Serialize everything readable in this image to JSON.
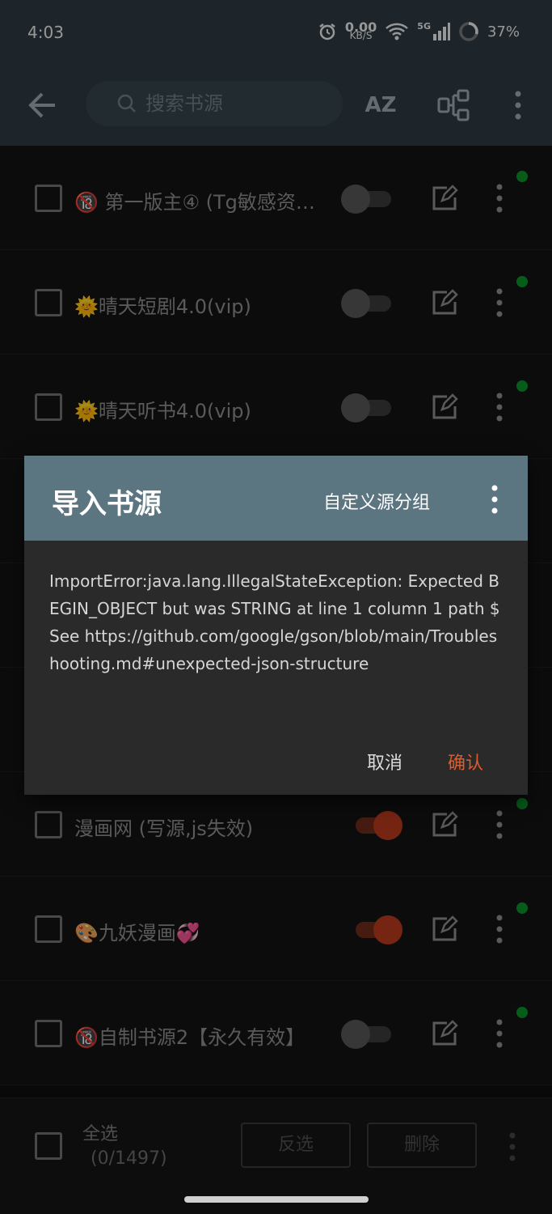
{
  "status_bar": {
    "time": "4:03",
    "net_speed_value": "0.00",
    "net_speed_unit": "KB/S",
    "network": "5G",
    "battery": "37%"
  },
  "toolbar": {
    "search_placeholder": "搜索书源",
    "sort_label": "AZ"
  },
  "sources": [
    {
      "title": "🔞 第一版主④ (Tg敏感资…",
      "enabled": false
    },
    {
      "title": "🌞晴天短剧4.0(vip)",
      "enabled": false
    },
    {
      "title": "🌞晴天听书4.0(vip)",
      "enabled": false
    },
    {
      "title": "漫画网 (写源,js失效)",
      "enabled": true
    },
    {
      "title": "🎨九妖漫画💞",
      "enabled": true
    },
    {
      "title": "🔞自制书源2【永久有效】",
      "enabled": false
    }
  ],
  "bottom_bar": {
    "select_all_label": "全选",
    "select_count": "(0/1497)",
    "invert_label": "反选",
    "delete_label": "删除"
  },
  "dialog": {
    "title": "导入书源",
    "custom_group_label": "自定义源分组",
    "message": "ImportError:java.lang.IllegalStateException: Expected BEGIN_OBJECT but was STRING at line 1 column 1 path $\nSee https://github.com/google/gson/blob/main/Troubleshooting.md#unexpected-json-structure",
    "cancel_label": "取消",
    "confirm_label": "确认"
  },
  "colors": {
    "toolbar_bg": "#2f3a41",
    "dialog_header_bg": "#5b7581",
    "accent": "#e05a2a",
    "switch_on": "#b53a1c",
    "status_dot": "#0a8f27"
  }
}
